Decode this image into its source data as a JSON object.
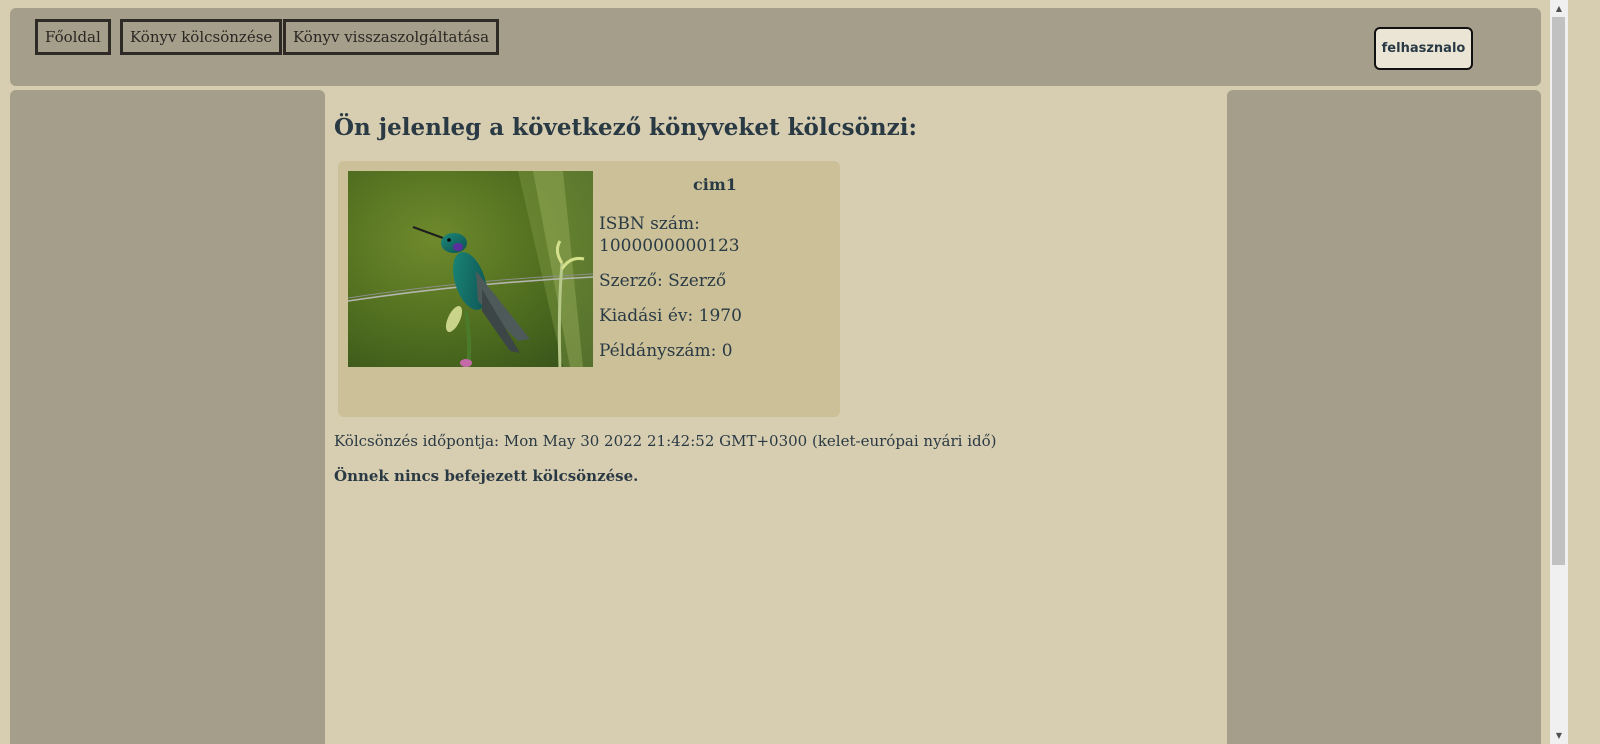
{
  "nav": {
    "home": "Főoldal",
    "borrow": "Könyv kölcsönzése",
    "return": "Könyv visszaszolgáltatása"
  },
  "user": {
    "label": "felhasznalo"
  },
  "main": {
    "title": "Ön jelenleg a következő könyveket kölcsönzi:",
    "book": {
      "title": "cim1",
      "isbn_label": "ISBN szám:",
      "isbn": "1000000000123",
      "author": "Szerző: Szerző",
      "year": "Kiadási év: 1970",
      "copies": "Példányszám: 0",
      "cover_icon": "hummingbird-photo"
    },
    "loan_time": "Kölcsönzés időpontja: Mon May 30 2022 21:42:52 GMT+0300 (kelet-európai nyári idő)",
    "no_finished": "Önnek nincs befejezett kölcsönzése."
  },
  "colors": {
    "background": "#d7cdb0",
    "panel": "#a49e8b",
    "card": "#cbc098",
    "text": "#2a3a44"
  }
}
